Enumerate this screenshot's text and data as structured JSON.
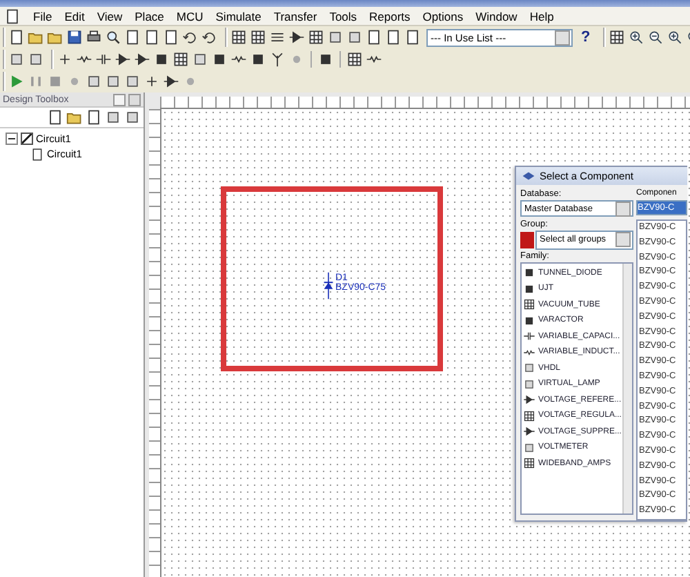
{
  "menu": [
    "File",
    "Edit",
    "View",
    "Place",
    "MCU",
    "Simulate",
    "Transfer",
    "Tools",
    "Reports",
    "Options",
    "Window",
    "Help"
  ],
  "in_use_list": {
    "value": "--- In Use List ---"
  },
  "help_button": "?",
  "design_toolbox": {
    "title": "Design Toolbox",
    "tree": [
      {
        "label": "Circuit1",
        "checked": true,
        "expanded": true,
        "children": [
          {
            "label": "Circuit1"
          }
        ]
      }
    ]
  },
  "canvas": {
    "component": {
      "ref": "D1",
      "value": "BZV90-C75"
    }
  },
  "dialog": {
    "title": "Select a Component",
    "database_label": "Database:",
    "database": "Master Database",
    "group_label": "Group:",
    "group": "Select all groups",
    "family_label": "Family:",
    "families": [
      "TUNNEL_DIODE",
      "UJT",
      "VACUUM_TUBE",
      "VARACTOR",
      "VARIABLE_CAPACI...",
      "VARIABLE_INDUCT...",
      "VHDL",
      "VIRTUAL_LAMP",
      "VOLTAGE_REFERE...",
      "VOLTAGE_REGULA...",
      "VOLTAGE_SUPPRE...",
      "VOLTMETER",
      "WIDEBAND_AMPS"
    ],
    "component_label": "Componen",
    "component_value": "BZV90-C",
    "components": [
      "BZV90-C",
      "BZV90-C",
      "BZV90-C",
      "BZV90-C",
      "BZV90-C",
      "BZV90-C",
      "BZV90-C",
      "BZV90-C",
      "BZV90-C",
      "BZV90-C",
      "BZV90-C",
      "BZV90-C",
      "BZV90-C",
      "BZV90-C",
      "BZV90-C",
      "BZV90-C",
      "BZV90-C",
      "BZV90-C",
      "BZV90-C",
      "BZV90-C"
    ]
  }
}
